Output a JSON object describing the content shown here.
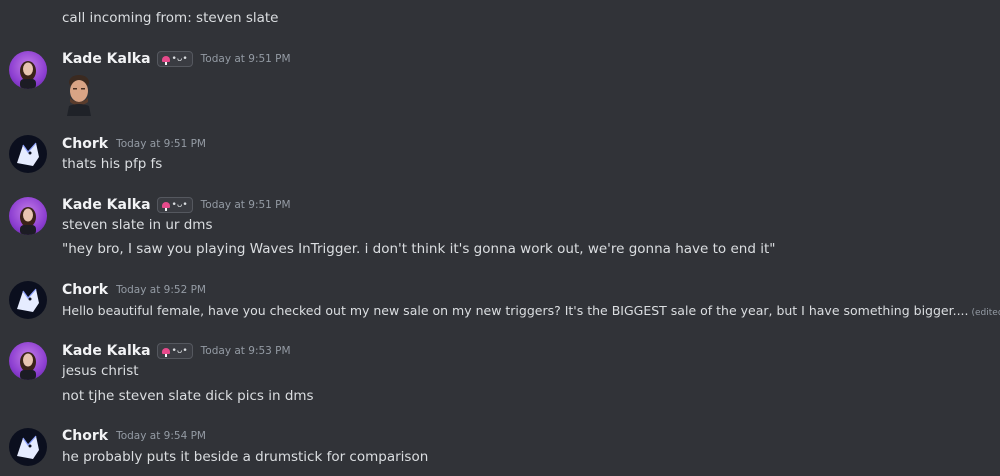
{
  "system": {
    "text": "call incoming from: steven slate"
  },
  "messages": [
    {
      "author": "Kade Kalka",
      "time": "Today at 9:51 PM",
      "tag": "•ᴗ•",
      "lines": []
    },
    {
      "author": "Chork",
      "time": "Today at 9:51 PM",
      "lines": [
        "thats his pfp fs"
      ]
    },
    {
      "author": "Kade Kalka",
      "time": "Today at 9:51 PM",
      "tag": "•ᴗ•",
      "lines": [
        "steven slate in ur dms",
        "\"hey bro, I saw you playing Waves InTrigger. i don't think it's gonna work out, we're gonna have to end it\""
      ]
    },
    {
      "author": "Chork",
      "time": "Today at 9:52 PM",
      "lines": [
        "Hello beautiful female, have you checked out my new sale on my new triggers? It's the BIGGEST sale of the year, but I have something bigger...."
      ],
      "edited": "(edited)"
    },
    {
      "author": "Kade Kalka",
      "time": "Today at 9:53 PM",
      "tag": "•ᴗ•",
      "lines": [
        "jesus christ",
        "not tjhe steven slate dick pics in dms"
      ]
    },
    {
      "author": "Chork",
      "time": "Today at 9:54 PM",
      "lines": [
        "he probably puts it beside a drumstick for comparison"
      ]
    }
  ],
  "colors": {
    "background": "#313338",
    "text": "#dbdee1",
    "username": "#f2f3f5",
    "timestamp": "#949ba4"
  },
  "icons": {
    "kade_avatar": "girl-avatar-icon",
    "chork_avatar": "wolf-avatar-icon",
    "sticker": "man-face-sticker",
    "tag_icon": "mushroom-icon"
  }
}
